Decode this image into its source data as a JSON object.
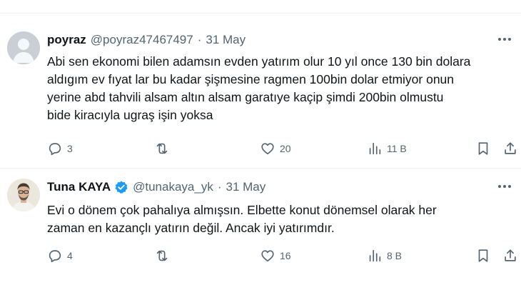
{
  "tweets": [
    {
      "name": "poyraz",
      "handle": "@poyraz47467497",
      "separator": "·",
      "date": "31 May",
      "verified": false,
      "avatar": "default-avatar",
      "text_lines": [
        "Abi sen ekonomi bilen adamsın evden yatırım olur 10 yıl once 130 bin dolara",
        "aldıgım ev fıyat lar bu kadar şişmesine ragmen 100bin dolar etmiyor onun",
        "yerine abd tahvili alsam altın alsam garatıye kaçip şimdi 200bin olmustu",
        "bide kiracıyla ugraş işin yoksa"
      ],
      "replies": "3",
      "retweets": "",
      "likes": "20",
      "views": "11 B"
    },
    {
      "name": "Tuna KAYA",
      "handle": "@tunakaya_yk",
      "separator": "·",
      "date": "31 May",
      "verified": true,
      "avatar": "profile-photo",
      "text_lines": [
        "Evi o dönem çok pahalıya almışsın. Elbette konut dönemsel olarak her",
        "zaman en kazançlı yatırın değil. Ancak iyi yatırımdır."
      ],
      "replies": "4",
      "retweets": "",
      "likes": "16",
      "views": "8 B"
    }
  ],
  "colors": {
    "text_primary": "#0f1419",
    "text_secondary": "#536471",
    "verified_blue": "#1d9bf0",
    "divider": "#eff3f4"
  },
  "icons": [
    "more-icon",
    "reply-icon",
    "retweet-icon",
    "like-icon",
    "views-icon",
    "bookmark-icon",
    "share-icon",
    "verified-badge-icon"
  ]
}
